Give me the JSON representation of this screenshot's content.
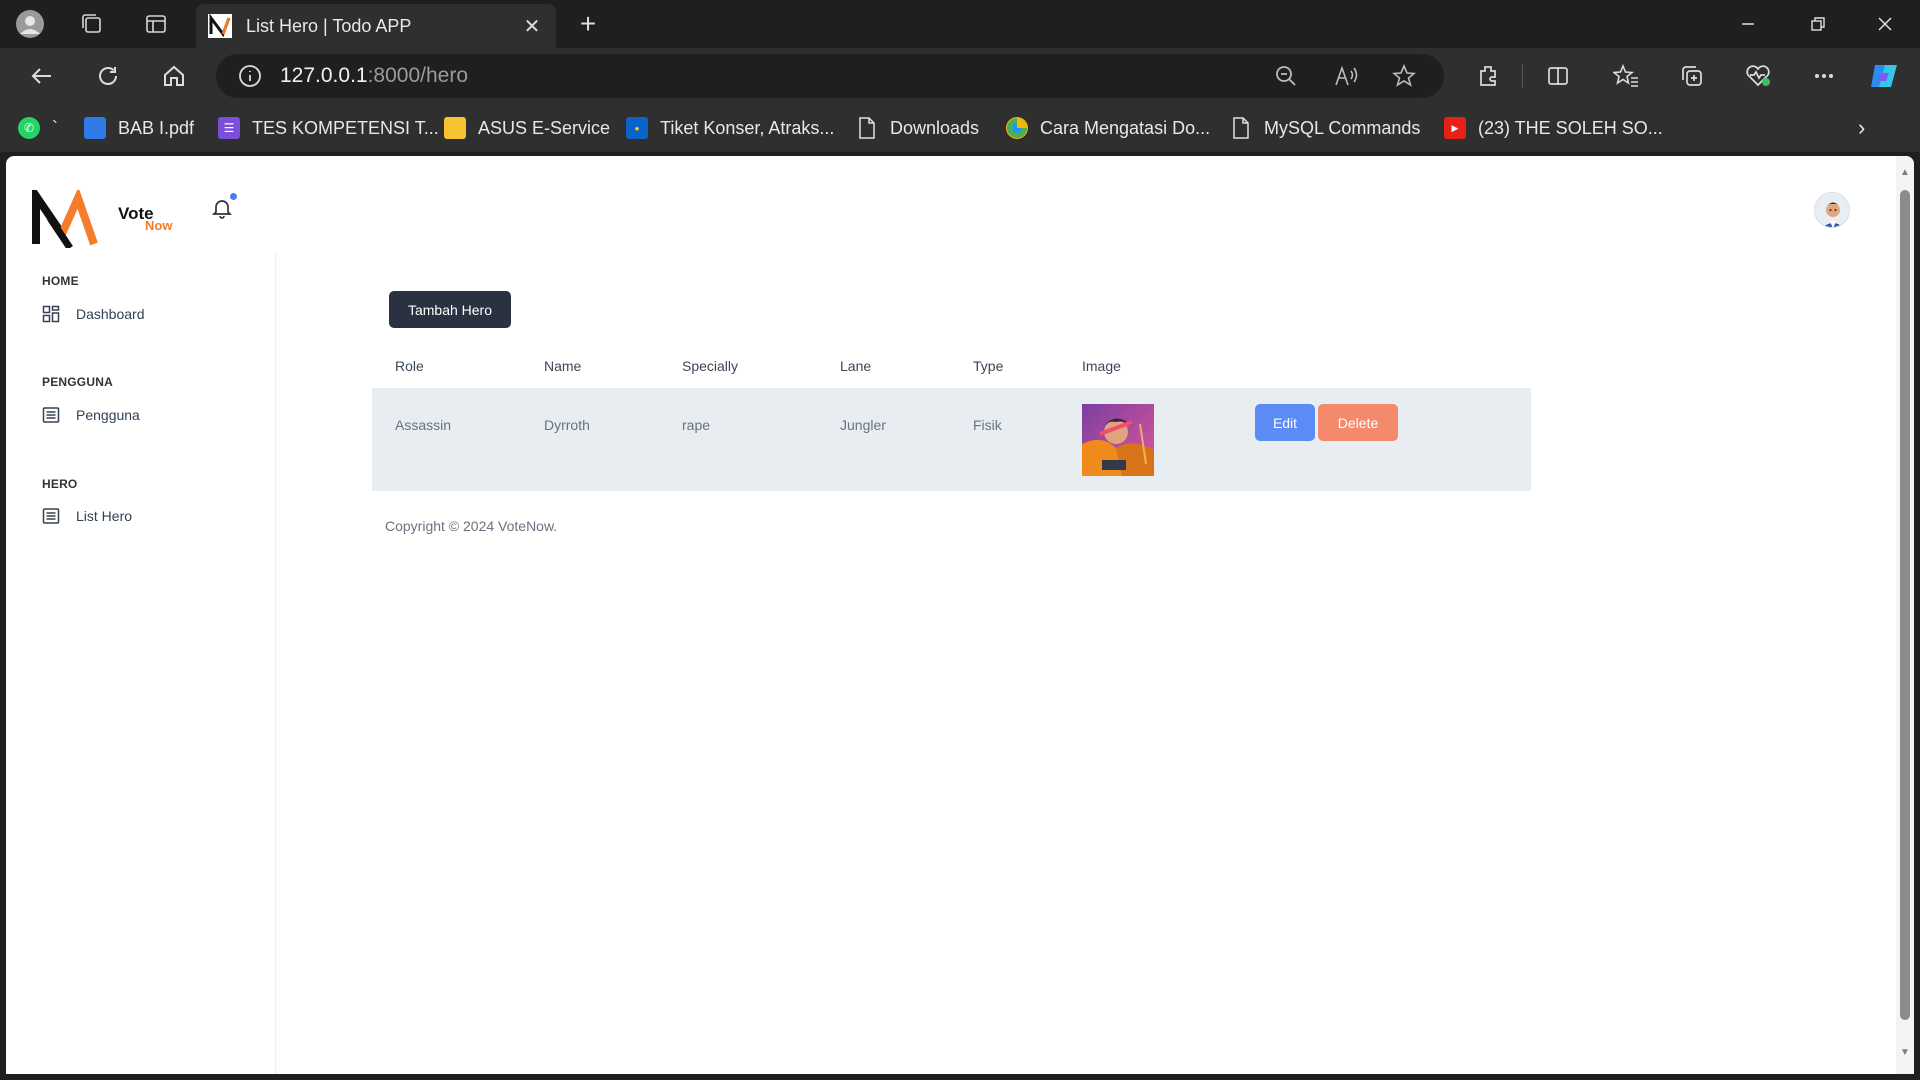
{
  "browser": {
    "tab_title": "List Hero | Todo APP",
    "url_host": "127.0.0.1",
    "url_rest": ":8000/hero"
  },
  "bookmarks": [
    {
      "label": "`",
      "icon": "whatsapp-icon"
    },
    {
      "label": "BAB I.pdf",
      "icon": "file-icon"
    },
    {
      "label": "TES KOMPETENSI T...",
      "icon": "form-icon"
    },
    {
      "label": "ASUS E-Service",
      "icon": "folder-icon"
    },
    {
      "label": "Tiket Konser, Atraks...",
      "icon": "tiket-icon"
    },
    {
      "label": "Downloads",
      "icon": "page-icon"
    },
    {
      "label": "Cara Mengatasi Do...",
      "icon": "globe-icon"
    },
    {
      "label": "MySQL Commands",
      "icon": "page-icon"
    },
    {
      "label": "(23) THE SOLEH SO...",
      "icon": "youtube-icon"
    }
  ],
  "app": {
    "brand_top": "Vote",
    "brand_bottom": "Now",
    "brand_accent": "#f47c2a"
  },
  "sidebar": {
    "sections": [
      {
        "title": "HOME",
        "item": "Dashboard",
        "icon": "dashboard-icon"
      },
      {
        "title": "PENGGUNA",
        "item": "Pengguna",
        "icon": "list-icon"
      },
      {
        "title": "HERO",
        "item": "List Hero",
        "icon": "list-icon"
      }
    ]
  },
  "main": {
    "add_button": "Tambah Hero",
    "table": {
      "headers": [
        "Role",
        "Name",
        "Specially",
        "Lane",
        "Type",
        "Image"
      ],
      "rows": [
        {
          "role": "Assassin",
          "name": "Dyrroth",
          "specially": "rape",
          "lane": "Jungler",
          "type": "Fisik",
          "edit": "Edit",
          "delete": "Delete"
        }
      ]
    },
    "footer": "Copyright © 2024 VoteNow."
  }
}
